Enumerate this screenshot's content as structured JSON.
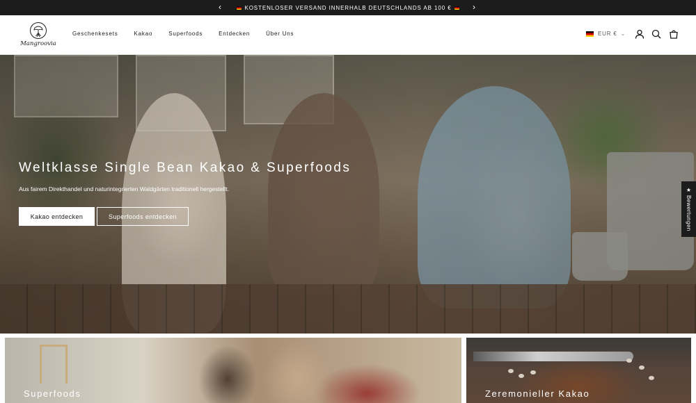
{
  "announcement": {
    "text": "KOSTENLOSER VERSAND INNERHALB DEUTSCHLANDS AB 100 €",
    "prev_icon": "chevron-left-icon",
    "next_icon": "chevron-right-icon"
  },
  "header": {
    "logo_text": "Mangroovia",
    "nav": [
      "Geschenkesets",
      "Kakao",
      "Superfoods",
      "Entdecken",
      "Über Uns"
    ],
    "currency": "EUR €",
    "icons": [
      "account-icon",
      "search-icon",
      "cart-icon"
    ]
  },
  "hero": {
    "title": "Weltklasse Single Bean Kakao & Superfoods",
    "subtitle": "Aus fairem Direkthandel und naturintegrierten Waldgärten traditionell hergestellt.",
    "primary_button": "Kakao entdecken",
    "secondary_button": "Superfoods entdecken"
  },
  "reviews_tab": {
    "label": "★ Bewertungen"
  },
  "tiles": [
    {
      "label": "Superfoods"
    },
    {
      "label": "Zeremonieller Kakao"
    }
  ]
}
